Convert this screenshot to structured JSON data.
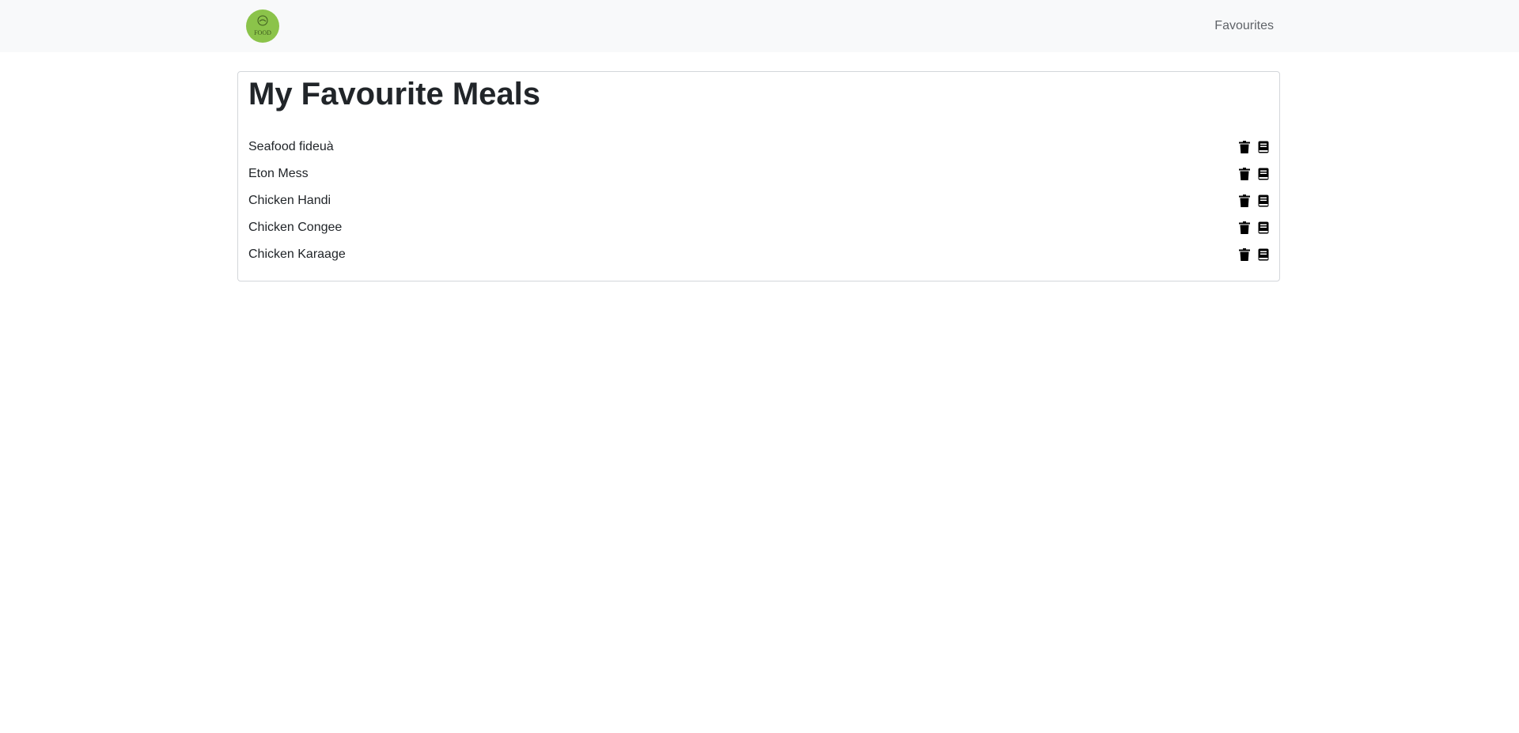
{
  "navbar": {
    "logo_text": "FOOD",
    "favourites_link": "Favourites"
  },
  "main": {
    "title": "My Favourite Meals",
    "meals": [
      {
        "name": "Seafood fideuà"
      },
      {
        "name": "Eton Mess"
      },
      {
        "name": "Chicken Handi"
      },
      {
        "name": "Chicken Congee"
      },
      {
        "name": "Chicken Karaage"
      }
    ],
    "action_icons": [
      "trash-icon",
      "book-icon"
    ]
  },
  "colors": {
    "navbar_bg": "#f8f9fa",
    "logo_bg": "#8bc34a",
    "text": "#212529",
    "nav_link": "#5f6368",
    "card_border": "#d3d6da"
  }
}
